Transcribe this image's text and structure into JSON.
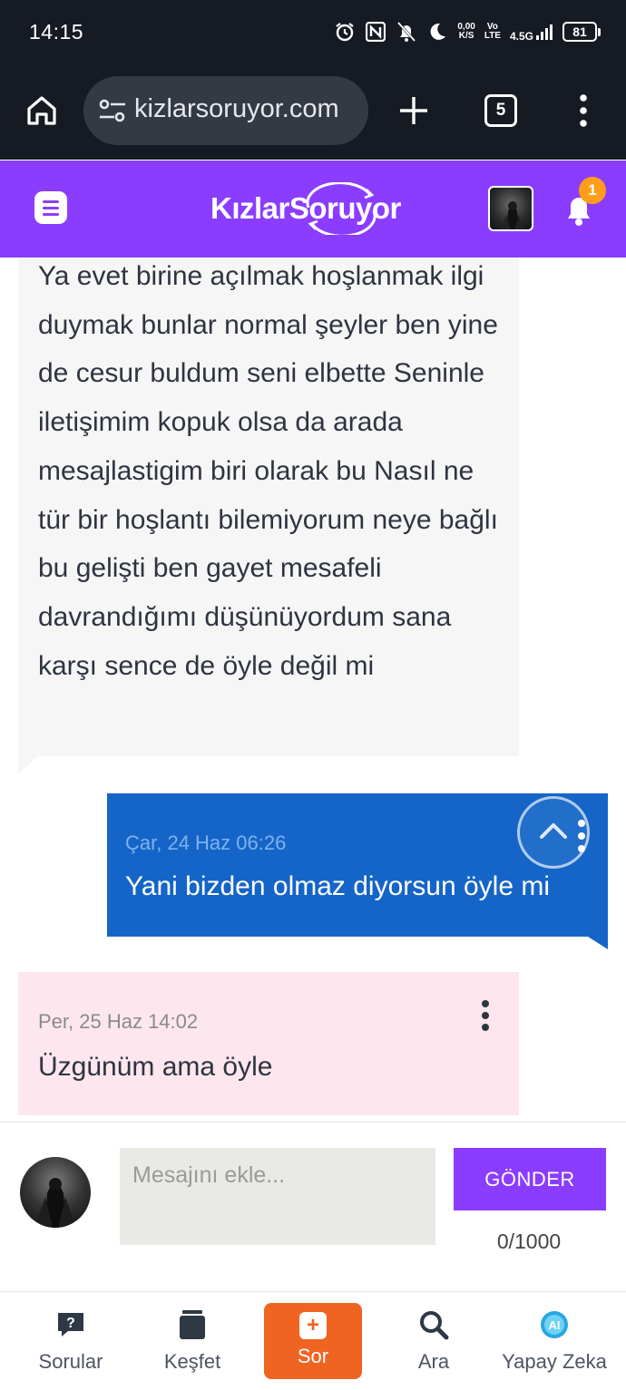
{
  "status_bar": {
    "time": "14:15",
    "net_speed": "0,00",
    "net_unit": "K/S",
    "volte": "Vo",
    "lte": "LTE",
    "network": "4.5G",
    "battery": "81",
    "icons": [
      "alarm-icon",
      "nfc-icon",
      "silent-icon",
      "moon-icon",
      "signal-icon",
      "battery-icon"
    ]
  },
  "browser": {
    "url": "kizlarsoruyor.com",
    "tab_count": "5"
  },
  "site_header": {
    "logo_part1": "Kızlar",
    "logo_part2": "Soruyor",
    "notification_count": "1",
    "brand_color": "#8b3dff"
  },
  "messages": [
    {
      "direction": "incoming",
      "text": "Ya evet birine açılmak hoşlanmak ilgi duymak bunlar normal şeyler ben yine de cesur buldum seni elbette Seninle iletişimim kopuk olsa da arada mesajlastigim biri olarak bu Nasıl ne tür bir hoşlantı bilemiyorum neye bağlı bu gelişti ben gayet mesafeli davrandığımı düşünüyordum sana karşı sence de öyle değil mi"
    },
    {
      "direction": "outgoing",
      "timestamp": "Çar, 24 Haz 06:26",
      "text": "Yani bizden olmaz diyorsun öyle mi"
    },
    {
      "direction": "incoming",
      "timestamp": "Per, 25 Haz 14:02",
      "text": "Üzgünüm ama öyle"
    }
  ],
  "composer": {
    "placeholder": "Mesajını ekle...",
    "value": "",
    "send_label": "GÖNDER",
    "counter": "0/1000"
  },
  "bottom_nav": [
    {
      "label": "Sorular",
      "icon": "question-bubble-icon"
    },
    {
      "label": "Keşfet",
      "icon": "cards-stack-icon"
    },
    {
      "label": "Sor",
      "icon": "plus-icon"
    },
    {
      "label": "Ara",
      "icon": "search-icon"
    },
    {
      "label": "Yapay Zeka",
      "icon": "ai-icon"
    }
  ]
}
